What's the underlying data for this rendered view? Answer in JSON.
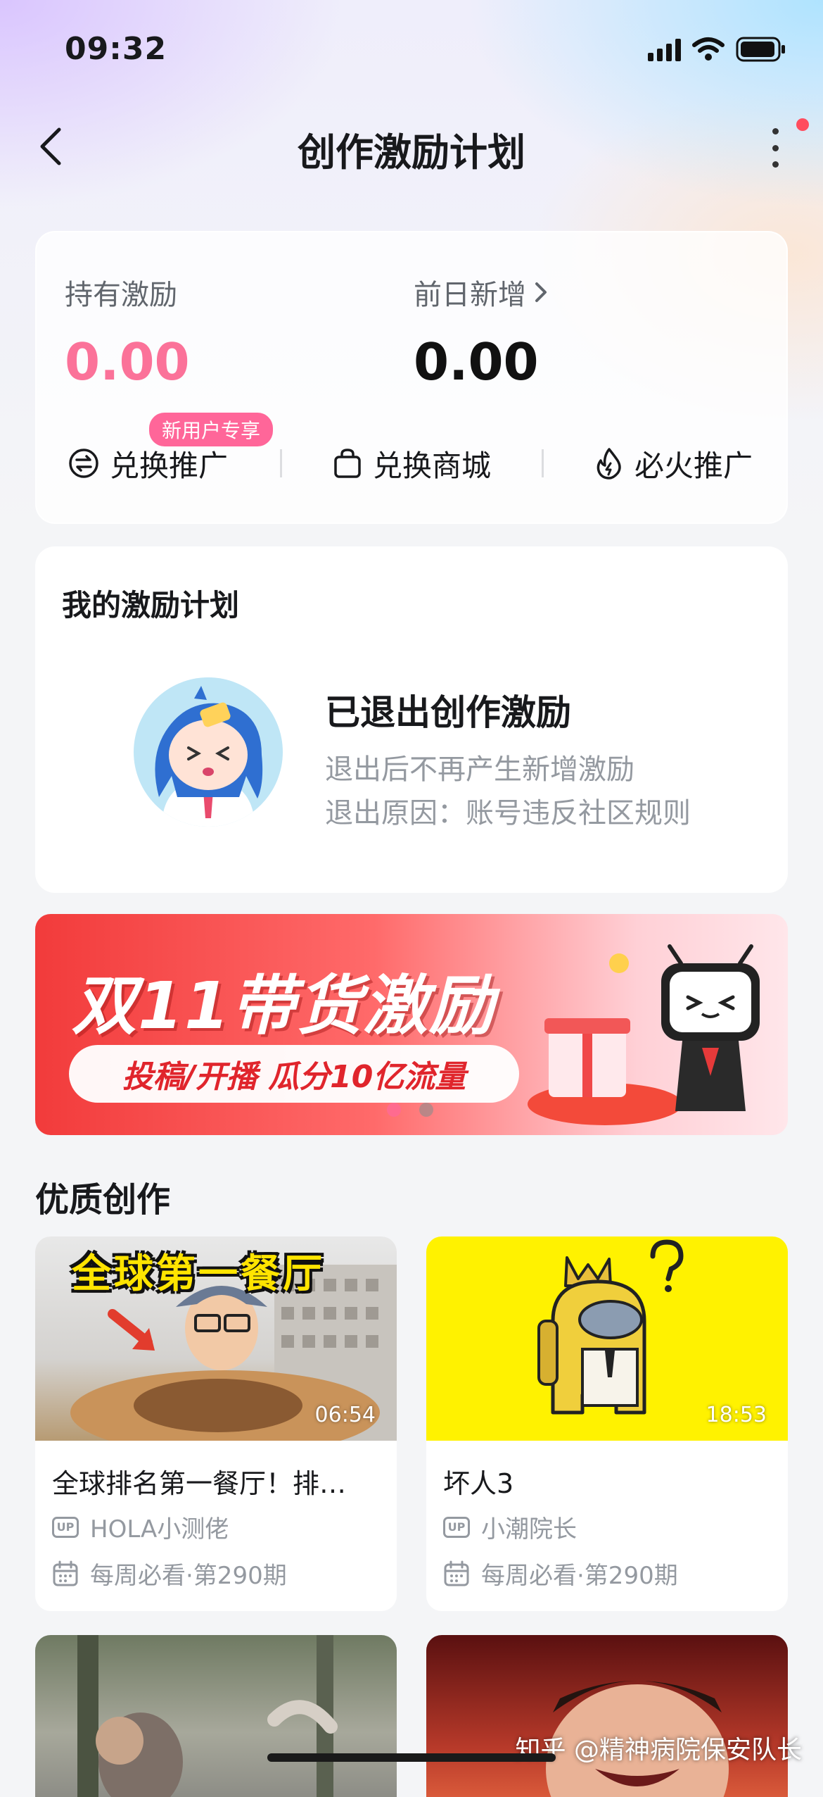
{
  "status_bar": {
    "time": "09:32"
  },
  "nav": {
    "title": "创作激励计划"
  },
  "wallet": {
    "held_label": "持有激励",
    "held_value": "0.00",
    "yesterday_label": "前日新增",
    "yesterday_value": "0.00",
    "new_user_badge": "新用户专享",
    "actions": [
      {
        "label": "兑换推广",
        "icon": "exchange-icon"
      },
      {
        "label": "兑换商城",
        "icon": "shopping-bag-icon"
      },
      {
        "label": "必火推广",
        "icon": "flame-icon"
      }
    ],
    "colors": {
      "held_value": "#fb7299",
      "badge": "#ff6699"
    }
  },
  "plan": {
    "title": "我的激励计划",
    "status": "已退出创作激励",
    "desc_line1": "退出后不再产生新增激励",
    "desc_line2": "退出原因：账号违反社区规则"
  },
  "banner": {
    "title": "双11带货激励",
    "subtitle": "投稿/开播 瓜分10亿流量",
    "page_count": 2,
    "active_page": 0
  },
  "section": {
    "title": "优质创作"
  },
  "videos": [
    {
      "thumb_caption": "全球第一餐厅",
      "duration": "06:54",
      "title": "全球排名第一餐厅！排…",
      "author": "HOLA小测佬",
      "column": "每周必看·第290期"
    },
    {
      "duration": "18:53",
      "title": "坏人3",
      "author": "小潮院长",
      "column": "每周必看·第290期"
    }
  ],
  "up_badge": "UP",
  "watermark": "知乎 @精神病院保安队长"
}
